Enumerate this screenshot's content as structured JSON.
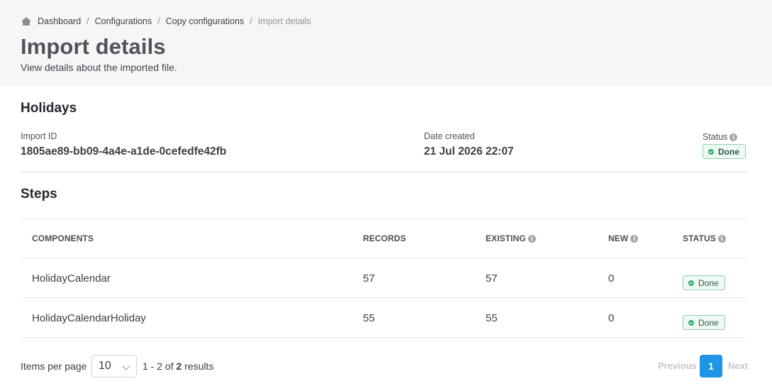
{
  "breadcrumb": {
    "items": [
      "Dashboard",
      "Configurations",
      "Copy configurations"
    ],
    "separator": "/",
    "current": "Import details"
  },
  "page": {
    "title": "Import details",
    "subtitle": "View details about the imported file."
  },
  "import": {
    "title": "Holidays",
    "id_label": "Import ID",
    "id_value": "1805ae89-bb09-4a4e-a1de-0cefedfe42fb",
    "date_label": "Date created",
    "date_value": "21 Jul 2026 22:07",
    "status_label": "Status",
    "status_value": "Done"
  },
  "steps": {
    "title": "Steps",
    "columns": {
      "components": "COMPONENTS",
      "records": "RECORDS",
      "existing": "EXISTING",
      "new": "NEW",
      "status": "STATUS"
    },
    "rows": [
      {
        "component": "HolidayCalendar",
        "records": "57",
        "existing": "57",
        "new": "0",
        "status": "Done"
      },
      {
        "component": "HolidayCalendarHoliday",
        "records": "55",
        "existing": "55",
        "new": "0",
        "status": "Done"
      }
    ]
  },
  "pagination": {
    "items_per_page_label": "Items per page",
    "items_per_page_value": "10",
    "results_prefix": "1 - 2 of",
    "results_total": "2",
    "results_suffix": "results",
    "previous": "Previous",
    "current_page": "1",
    "next": "Next"
  },
  "icons": {
    "home": "home-icon",
    "info": "info-icon",
    "status_done": "check-circle-icon",
    "dropdown": "chevron-down-icon"
  },
  "colors": {
    "accent": "#1e95e5",
    "success": "#2faa73"
  }
}
